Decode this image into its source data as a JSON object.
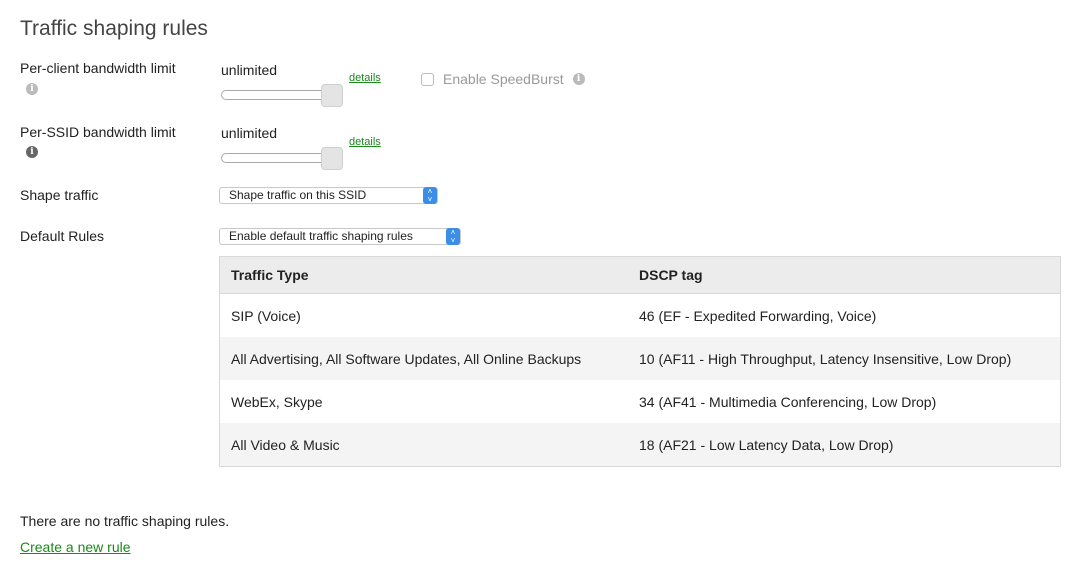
{
  "section_title": "Traffic shaping rules",
  "per_client": {
    "label": "Per-client bandwidth limit",
    "info_icon": "info-icon",
    "value_text": "unlimited",
    "slider_position": 1.0,
    "details_link": "details",
    "speedburst": {
      "label": "Enable SpeedBurst",
      "checked": false,
      "info_icon": "info-icon"
    }
  },
  "per_ssid": {
    "label": "Per-SSID bandwidth limit",
    "info_icon": "info-icon",
    "value_text": "unlimited",
    "slider_position": 1.0,
    "details_link": "details"
  },
  "shape_traffic": {
    "label": "Shape traffic",
    "selected": "Shape traffic on this SSID"
  },
  "default_rules": {
    "label": "Default Rules",
    "selected": "Enable default traffic shaping rules"
  },
  "rules_table": {
    "columns": [
      "Traffic Type",
      "DSCP tag"
    ],
    "rows": [
      [
        "SIP (Voice)",
        "46 (EF - Expedited Forwarding, Voice)"
      ],
      [
        "All Advertising, All Software Updates, All Online Backups",
        "10 (AF11 - High Throughput, Latency Insensitive, Low Drop)"
      ],
      [
        "WebEx, Skype",
        "34 (AF41 - Multimedia Conferencing, Low Drop)"
      ],
      [
        "All Video & Music",
        "18 (AF21 - Low Latency Data, Low Drop)"
      ]
    ]
  },
  "no_rules_text": "There are no traffic shaping rules.",
  "create_rule_link": "Create a new rule",
  "colors": {
    "link": "#1a8a1a",
    "select_accent": "#3a8ee8",
    "header_bg": "#ececec"
  }
}
